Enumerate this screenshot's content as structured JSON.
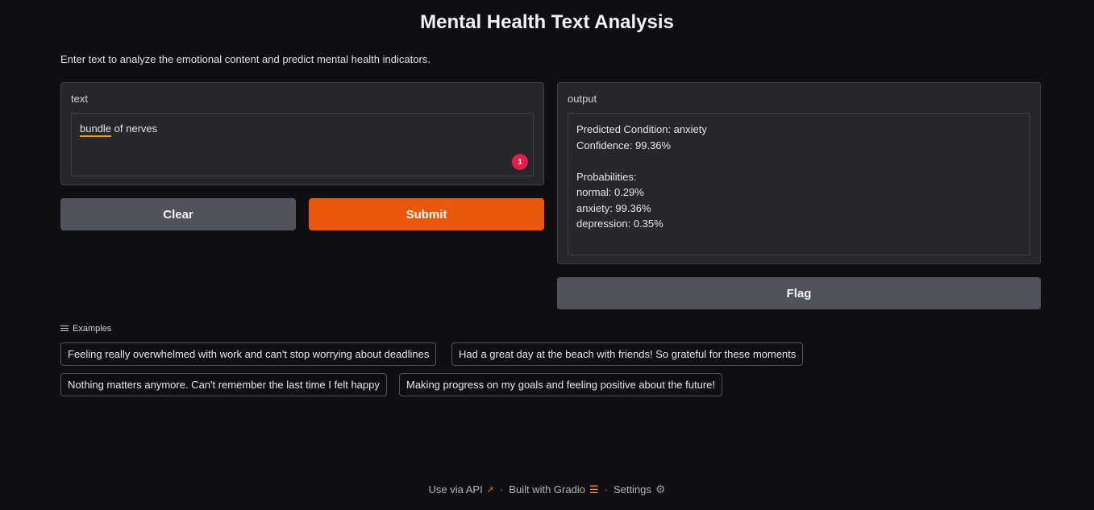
{
  "header": {
    "title": "Mental Health Text Analysis",
    "description": "Enter text to analyze the emotional content and predict mental health indicators."
  },
  "input": {
    "label": "text",
    "value_first_word": "bundle",
    "value_rest": " of nerves",
    "badge_count": "1"
  },
  "output": {
    "label": "output",
    "lines": [
      "Predicted Condition: anxiety",
      "Confidence: 99.36%",
      "",
      "Probabilities:",
      "normal: 0.29%",
      "anxiety: 99.36%",
      "depression: 0.35%"
    ]
  },
  "buttons": {
    "clear": "Clear",
    "submit": "Submit",
    "flag": "Flag"
  },
  "examples": {
    "header": "Examples",
    "items": [
      "Feeling really overwhelmed with work and can't stop worrying about deadlines",
      "Had a great day at the beach with friends! So grateful for these moments",
      "Nothing matters anymore. Can't remember the last time I felt happy",
      "Making progress on my goals and feeling positive about the future!"
    ]
  },
  "footer": {
    "api": "Use via API",
    "built": "Built with Gradio",
    "settings": "Settings",
    "separator": "·"
  },
  "colors": {
    "background": "#0f0f11",
    "panel": "#27272a",
    "accent": "#ea580c",
    "secondary_button": "#52525b",
    "badge": "#e11d48"
  },
  "icons": [
    "list-icon",
    "rocket-icon",
    "gradio-logo-icon",
    "gear-icon"
  ]
}
